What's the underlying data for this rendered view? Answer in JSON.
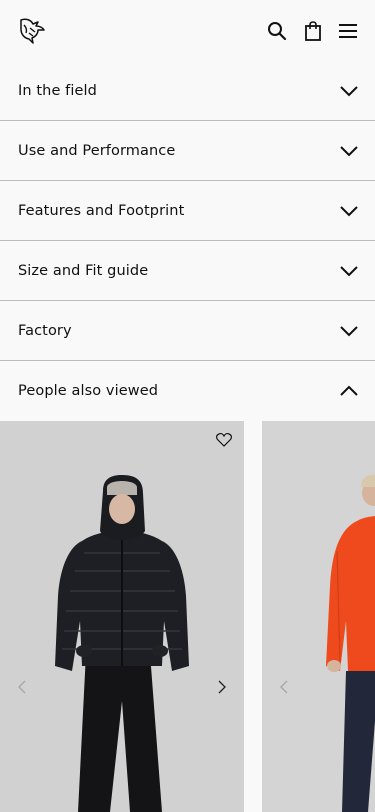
{
  "header": {
    "logo_icon": "mountain-bird-logo",
    "actions": [
      "search-icon",
      "shopping-bag-icon",
      "hamburger-menu-icon"
    ]
  },
  "accordion": {
    "items": [
      {
        "label": "In the field",
        "state": "collapsed"
      },
      {
        "label": "Use and Performance",
        "state": "collapsed"
      },
      {
        "label": "Features and Footprint",
        "state": "collapsed"
      },
      {
        "label": "Size and Fit guide",
        "state": "collapsed"
      },
      {
        "label": "Factory",
        "state": "collapsed"
      },
      {
        "label": "People also viewed",
        "state": "expanded"
      }
    ]
  },
  "carousel": {
    "products": [
      {
        "image": "black hooded down jacket with black pants",
        "favorite_icon": "heart-outline-icon"
      },
      {
        "image": "orange fleece jacket with navy pants",
        "favorite_icon": "heart-outline-icon"
      }
    ]
  },
  "colors": {
    "background": "#f9f9f9",
    "divider": "#bdbdbd",
    "card_background": "#d1d1d1",
    "accent_orange": "#ee4a1d"
  }
}
